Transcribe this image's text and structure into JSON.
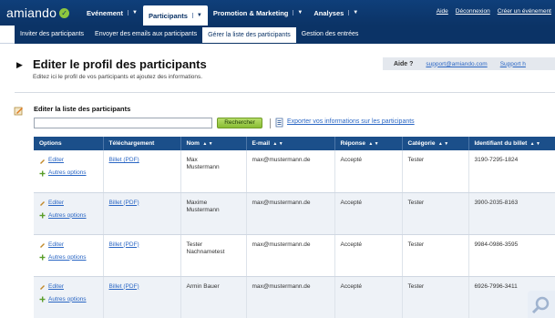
{
  "logo": {
    "text": "amiando"
  },
  "topnav": {
    "items": [
      {
        "label": "Evénement"
      },
      {
        "label": "Participants"
      },
      {
        "label": "Promotion & Marketing"
      },
      {
        "label": "Analyses"
      }
    ],
    "links": [
      "Aide",
      "Déconnexion",
      "Créer un événement"
    ]
  },
  "subnav": {
    "tabs": [
      "Inviter des participants",
      "Envoyer des emails aux participants",
      "Gérer la liste des participants",
      "Gestion des entrées"
    ]
  },
  "header": {
    "title": "Editer le profil des participants",
    "subtitle": "Editez ici le profil de vos participants et ajoutez des informations.",
    "help_label": "Aide ?",
    "help_email": "support@amiando.com",
    "help_support": "Support h"
  },
  "section": {
    "title": "Editer la liste des participants",
    "search_value": "",
    "search_button": "Rechercher",
    "export_link": "Exporter vos informations sur les participants"
  },
  "table": {
    "columns": [
      "Options",
      "Téléchargement",
      "Nom",
      "E-mail",
      "Réponse",
      "Catégorie",
      "Identifiant du billet"
    ],
    "edit_label": "Editer",
    "options_label": "Autres options",
    "ticket_label": "Billet (PDF)",
    "rows": [
      {
        "name1": "Max",
        "name2": "Mustermann",
        "email": "max@mustermann.de",
        "response": "Accepté",
        "category": "Tester",
        "ticket_id": "3190-7295-1824"
      },
      {
        "name1": "Maxime",
        "name2": "Mustermann",
        "email": "max@mustermann.de",
        "response": "Accepté",
        "category": "Tester",
        "ticket_id": "3900-2035-8163"
      },
      {
        "name1": "Tester",
        "name2": "Nachnametest",
        "email": "max@mustermann.de",
        "response": "Accepté",
        "category": "Tester",
        "ticket_id": "9984-0986-3595"
      },
      {
        "name1": "Armin Bauer",
        "name2": "",
        "email": "max@mustermann.de",
        "response": "Accepté",
        "category": "Tester",
        "ticket_id": "6926-7996-3411"
      }
    ]
  },
  "colors": {
    "nav": "#0b3366",
    "header": "#1b4f8a",
    "link": "#2a66c4",
    "button": "#89bd34"
  }
}
